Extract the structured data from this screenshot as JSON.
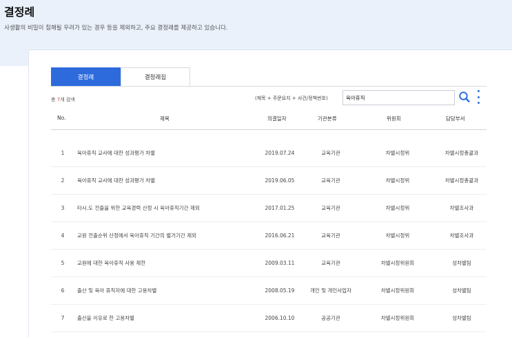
{
  "page": {
    "title": "결정례",
    "description": "사생활의 비밀이 침해될 우려가 있는 경우 등을 제외하고, 주요 결정례를 제공하고 있습니다."
  },
  "tabs": [
    {
      "label": "결정례",
      "active": true
    },
    {
      "label": "결정례집",
      "active": false
    }
  ],
  "result": {
    "prefix": "총",
    "count": "7",
    "suffix": "개 검색"
  },
  "search": {
    "label": "(제목 + 주문요지 + 사건/정책번호)",
    "value": "육아휴직",
    "icon": "search-icon",
    "more_icon": "more-vertical-icon"
  },
  "table": {
    "headers": [
      "No.",
      "제목",
      "의결일자",
      "기관분류",
      "위원회",
      "담당부서"
    ],
    "rows": [
      {
        "no": "1",
        "title": "육아휴직 교사에 대한 성과평가 차별",
        "date": "2019.07.24",
        "category": "교육기관",
        "committee": "차별시정위",
        "dept": "차별시정총괄과"
      },
      {
        "no": "2",
        "title": "육아휴직 교사에 대한 성과평가 차별",
        "date": "2019.06.05",
        "category": "교육기관",
        "committee": "차별시정위",
        "dept": "차별시정총괄과"
      },
      {
        "no": "3",
        "title": "타시.도 전출을 위한 교육경력 산정 시 육아휴직기간 제외",
        "date": "2017.01.25",
        "category": "교육기관",
        "committee": "차별시정위",
        "dept": "차별조사과"
      },
      {
        "no": "4",
        "title": "교원 전출순위 산정에서 육아휴직 기간의 별거기간 제외",
        "date": "2016.06.21",
        "category": "교육기관",
        "committee": "차별시정위",
        "dept": "차별조사과"
      },
      {
        "no": "5",
        "title": "교원에 대한 육아휴직 사용 제한",
        "date": "2009.03.11",
        "category": "교육기관",
        "committee": "차별시정위원회",
        "dept": "성차별팀"
      },
      {
        "no": "6",
        "title": "출산 및 육아 휴직자에 대한 고용차별",
        "date": "2008.05.19",
        "category": "개인 및 개인사업자",
        "committee": "차별시정위원회",
        "dept": "성차별팀"
      },
      {
        "no": "7",
        "title": "출산을 이유로 한 고용차별",
        "date": "2006.10.10",
        "category": "공공기관",
        "committee": "차별시정위원회",
        "dept": "성차별팀"
      }
    ]
  },
  "colors": {
    "accent": "#2d6bdd",
    "count": "#e0423a",
    "header_bg": "#eaf1fa"
  }
}
